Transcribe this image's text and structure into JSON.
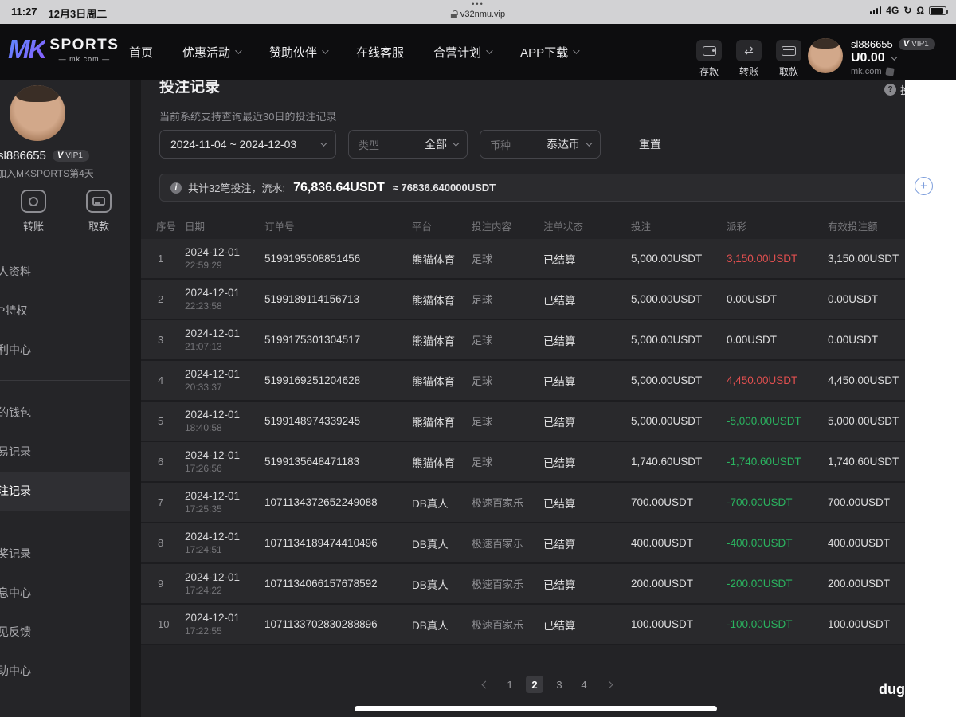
{
  "status_bar": {
    "time": "11:27",
    "date": "12月3日周二",
    "tab_dots": "•••",
    "url": "v32nmu.vip",
    "network": "4G"
  },
  "navbar": {
    "logo": {
      "mk": "MK",
      "sports": "SPORTS",
      "domain": "— mk.com —"
    },
    "menu": [
      {
        "label": "首页",
        "dropdown": false
      },
      {
        "label": "优惠活动",
        "dropdown": true
      },
      {
        "label": "赞助伙伴",
        "dropdown": true
      },
      {
        "label": "在线客服",
        "dropdown": false
      },
      {
        "label": "合营计划",
        "dropdown": true
      },
      {
        "label": "APP下载",
        "dropdown": true
      }
    ],
    "quick_actions": [
      {
        "label": "存款",
        "icon": "wallet-icon"
      },
      {
        "label": "转账",
        "icon": "transfer-icon"
      },
      {
        "label": "取款",
        "icon": "withdraw-icon"
      }
    ],
    "user": {
      "name": "sl886655",
      "vip_mark": "V",
      "vip_level": "VIP1",
      "balance": "U0.00",
      "site": "mk.com"
    }
  },
  "sidebar": {
    "username": "sl886655",
    "vip_mark": "V",
    "vip_level": "VIP1",
    "joined": "加入MKSPORTS第4天",
    "actions": [
      {
        "label": "转账"
      },
      {
        "label": "取款"
      }
    ],
    "items": [
      {
        "label": "人资料"
      },
      {
        "label": "P特权"
      },
      {
        "label": "利中心"
      },
      {
        "label": "的钱包"
      },
      {
        "label": "易记录"
      },
      {
        "label": "注记录"
      },
      {
        "label": "奖记录"
      },
      {
        "label": "息中心"
      },
      {
        "label": "见反馈"
      },
      {
        "label": "助中心"
      }
    ],
    "active_item": "注记录"
  },
  "main": {
    "title": "投注记录",
    "help_partial": "投",
    "subtitle": "当前系统支持查询最近30日的投注记录",
    "filters": {
      "date_range": "2024-11-04 ~ 2024-12-03",
      "type_label": "类型",
      "type_value": "全部",
      "currency_label": "币种",
      "currency_value": "泰达币",
      "reset_label": "重置"
    },
    "summary": {
      "prefix": "共计32笔投注，流水:",
      "amount": "76,836.64USDT",
      "approx": "≈ 76836.640000USDT"
    },
    "table": {
      "columns": [
        "序号",
        "日期",
        "订单号",
        "平台",
        "投注内容",
        "注单状态",
        "投注",
        "派彩",
        "有效投注额"
      ],
      "rows": [
        {
          "seq": "1",
          "date": "2024-12-01",
          "time": "22:59:29",
          "order": "5199195508851456",
          "platform": "熊猫体育",
          "content": "足球",
          "status": "已结算",
          "bet": "5,000.00USDT",
          "payout": "3,150.00USDT",
          "payout_color": "red",
          "valid": "3,150.00USDT"
        },
        {
          "seq": "2",
          "date": "2024-12-01",
          "time": "22:23:58",
          "order": "5199189114156713",
          "platform": "熊猫体育",
          "content": "足球",
          "status": "已结算",
          "bet": "5,000.00USDT",
          "payout": "0.00USDT",
          "payout_color": "white",
          "valid": "0.00USDT"
        },
        {
          "seq": "3",
          "date": "2024-12-01",
          "time": "21:07:13",
          "order": "5199175301304517",
          "platform": "熊猫体育",
          "content": "足球",
          "status": "已结算",
          "bet": "5,000.00USDT",
          "payout": "0.00USDT",
          "payout_color": "white",
          "valid": "0.00USDT"
        },
        {
          "seq": "4",
          "date": "2024-12-01",
          "time": "20:33:37",
          "order": "5199169251204628",
          "platform": "熊猫体育",
          "content": "足球",
          "status": "已结算",
          "bet": "5,000.00USDT",
          "payout": "4,450.00USDT",
          "payout_color": "red",
          "valid": "4,450.00USDT"
        },
        {
          "seq": "5",
          "date": "2024-12-01",
          "time": "18:40:58",
          "order": "5199148974339245",
          "platform": "熊猫体育",
          "content": "足球",
          "status": "已结算",
          "bet": "5,000.00USDT",
          "payout": "-5,000.00USDT",
          "payout_color": "green",
          "valid": "5,000.00USDT"
        },
        {
          "seq": "6",
          "date": "2024-12-01",
          "time": "17:26:56",
          "order": "5199135648471183",
          "platform": "熊猫体育",
          "content": "足球",
          "status": "已结算",
          "bet": "1,740.60USDT",
          "payout": "-1,740.60USDT",
          "payout_color": "green",
          "valid": "1,740.60USDT"
        },
        {
          "seq": "7",
          "date": "2024-12-01",
          "time": "17:25:35",
          "order": "1071134372652249088",
          "platform": "DB真人",
          "content": "极速百家乐",
          "status": "已结算",
          "bet": "700.00USDT",
          "payout": "-700.00USDT",
          "payout_color": "green",
          "valid": "700.00USDT"
        },
        {
          "seq": "8",
          "date": "2024-12-01",
          "time": "17:24:51",
          "order": "1071134189474410496",
          "platform": "DB真人",
          "content": "极速百家乐",
          "status": "已结算",
          "bet": "400.00USDT",
          "payout": "-400.00USDT",
          "payout_color": "green",
          "valid": "400.00USDT"
        },
        {
          "seq": "9",
          "date": "2024-12-01",
          "time": "17:24:22",
          "order": "1071134066157678592",
          "platform": "DB真人",
          "content": "极速百家乐",
          "status": "已结算",
          "bet": "200.00USDT",
          "payout": "-200.00USDT",
          "payout_color": "green",
          "valid": "200.00USDT"
        },
        {
          "seq": "10",
          "date": "2024-12-01",
          "time": "17:22:55",
          "order": "1071133702830288896",
          "platform": "DB真人",
          "content": "极速百家乐",
          "status": "已结算",
          "bet": "100.00USDT",
          "payout": "-100.00USDT",
          "payout_color": "green",
          "valid": "100.00USDT"
        }
      ]
    },
    "pagination": {
      "pages": [
        "1",
        "2",
        "3",
        "4"
      ],
      "current": "2"
    },
    "watermark": "dug",
    "floating_button": "+"
  },
  "colors": {
    "payout_win_red": "#e04f4f",
    "payout_loss_green": "#2ab35f",
    "accent_blue": "#7d9edc",
    "navbar_bg": "#0d0d0f",
    "panel_bg": "#232326",
    "statusbar_bg": "#d2d2d4"
  }
}
